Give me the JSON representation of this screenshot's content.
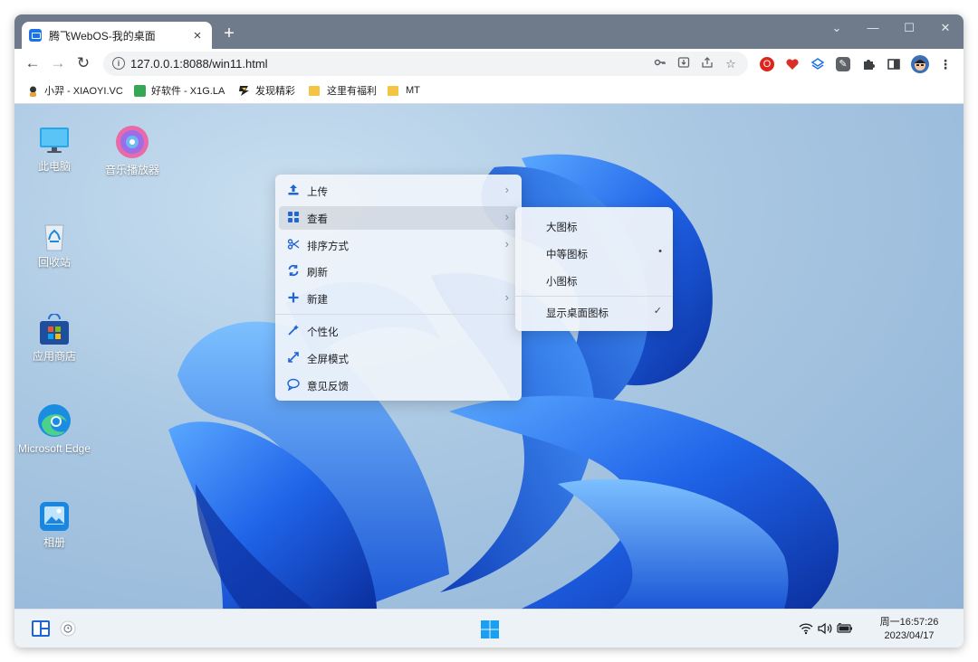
{
  "browser": {
    "tab_title": "腾飞WebOS-我的桌面",
    "tab_close": "×",
    "new_tab": "+",
    "window_controls": {
      "collapse": "⌄",
      "minimize": "—",
      "maximize": "☐",
      "close": "✕"
    },
    "nav": {
      "back": "←",
      "forward": "→",
      "reload": "↻"
    },
    "url": "127.0.0.1:8088/win11.html",
    "omnibox_icons": [
      "key-icon",
      "install-icon",
      "share-icon",
      "star-icon"
    ],
    "extensions": [
      "opera-icon",
      "heart-extension-icon",
      "layers-extension-icon",
      "edit-extension-icon",
      "puzzle-icon",
      "sidepanel-icon",
      "profile-avatar",
      "more-icon"
    ],
    "bookmarks": [
      {
        "label": "小羿 - XIAOYI.VC",
        "icon": "xiaoyi-icon"
      },
      {
        "label": "好软件 - X1G.LA",
        "icon": "x1g-icon"
      },
      {
        "label": "发现精彩",
        "icon": "discover-icon"
      },
      {
        "label": "这里有福利",
        "icon": "folder-icon"
      },
      {
        "label": "MT",
        "icon": "folder-icon"
      }
    ]
  },
  "desktop": {
    "icons": [
      {
        "label": "此电脑",
        "icon": "monitor-icon"
      },
      {
        "label": "音乐播放器",
        "icon": "music-player-icon"
      },
      {
        "label": "回收站",
        "icon": "recycle-bin-icon"
      },
      {
        "label": "应用商店",
        "icon": "store-icon"
      },
      {
        "label": "Microsoft Edge",
        "icon": "edge-icon"
      },
      {
        "label": "相册",
        "icon": "photos-icon"
      }
    ]
  },
  "context_menu": {
    "items": [
      {
        "label": "上传",
        "icon": "upload-icon",
        "has_submenu": true
      },
      {
        "label": "查看",
        "icon": "view-grid-icon",
        "has_submenu": true,
        "active": true
      },
      {
        "label": "排序方式",
        "icon": "sort-icon",
        "has_submenu": true
      },
      {
        "label": "刷新",
        "icon": "refresh-icon",
        "has_submenu": false
      },
      {
        "label": "新建",
        "icon": "new-icon",
        "has_submenu": true
      },
      {
        "label": "个性化",
        "icon": "personalize-icon",
        "has_submenu": false
      },
      {
        "label": "全屏模式",
        "icon": "fullscreen-icon",
        "has_submenu": false
      },
      {
        "label": "意见反馈",
        "icon": "feedback-icon",
        "has_submenu": false
      }
    ],
    "chevron": "›"
  },
  "view_submenu": {
    "items": [
      {
        "label": "大图标",
        "mark": ""
      },
      {
        "label": "中等图标",
        "mark": "•"
      },
      {
        "label": "小图标",
        "mark": ""
      },
      {
        "label": "显示桌面图标",
        "mark": "✓"
      }
    ]
  },
  "taskbar": {
    "clock_line1": "周一16:57:26",
    "clock_line2": "2023/04/17",
    "tray_icons": [
      "wifi-icon",
      "volume-icon",
      "battery-icon"
    ]
  },
  "colors": {
    "accent": "#1f65d6",
    "titlebar": "#6f7a8a",
    "folder": "#f4c542"
  }
}
